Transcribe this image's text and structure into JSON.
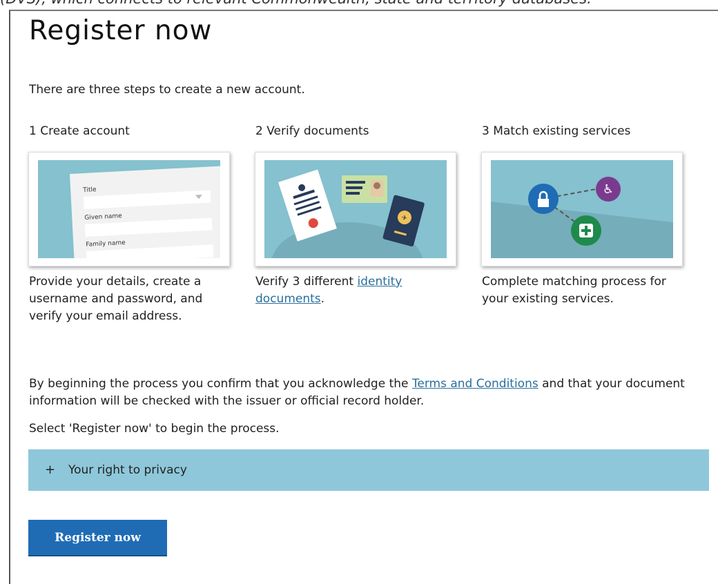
{
  "top_fragment": "(DVS), which connects to relevant Commonwealth, state and territory databases.",
  "page": {
    "title": "Register now",
    "intro": "There are three steps to create a new account."
  },
  "steps": [
    {
      "title": "1 Create account",
      "description": "Provide your details, create a username and password, and verify your email address.",
      "illustration": {
        "field_labels": [
          "Title",
          "Given name",
          "Family name"
        ]
      }
    },
    {
      "title": "2 Verify documents",
      "description_prefix": "Verify 3 different ",
      "description_link": "identity documents",
      "description_suffix": "."
    },
    {
      "title": "3 Match existing services",
      "description": "Complete matching process for your existing services."
    }
  ],
  "terms": {
    "prefix": "By beginning the process you confirm that you acknowledge the ",
    "link": "Terms and Conditions",
    "suffix": " and that your document information will be checked with the issuer or official record holder."
  },
  "instruction": "Select 'Register now' to begin the process.",
  "accordion": {
    "icon": "+",
    "label": "Your right to privacy"
  },
  "register_button": {
    "label": "Register now"
  },
  "colors": {
    "accordion_bg": "#8ec7da",
    "button_bg": "#1f6cb5",
    "link": "#2a6f9e",
    "illustration_bg": "#85c1ce"
  }
}
